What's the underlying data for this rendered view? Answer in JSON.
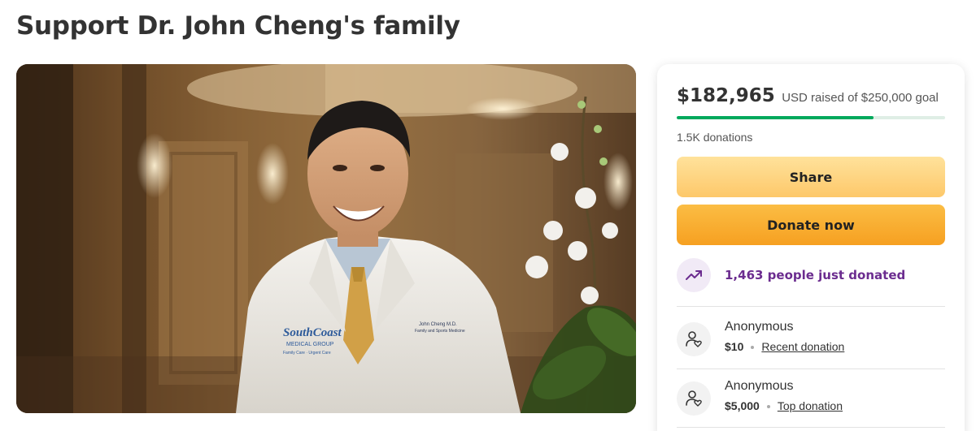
{
  "page": {
    "title": "Support Dr. John Cheng's family"
  },
  "hero_image": {
    "alt": "photo",
    "badge": {
      "logo_line1": "SouthCoast",
      "logo_line2": "MEDICAL GROUP",
      "logo_line3": "Family Care · Urgent Care",
      "name_line1": "John Cheng M.D.",
      "name_line2": "Family and Sports Medicine"
    }
  },
  "fundraiser": {
    "amount_raised": "$182,965",
    "raised_text": "USD raised of $250,000 goal",
    "progress_fraction": 0.7319,
    "donation_count": "1.5K donations",
    "share_label": "Share",
    "donate_label": "Donate now",
    "trend_text": "1,463 people just donated",
    "trend_icon": "trending-up-icon"
  },
  "donations": [
    {
      "name": "Anonymous",
      "amount": "$10",
      "tag": "Recent donation",
      "icon": "donor-heart-icon"
    },
    {
      "name": "Anonymous",
      "amount": "$5,000",
      "tag": "Top donation",
      "icon": "donor-heart-icon"
    }
  ],
  "colors": {
    "progress": "#02a95c",
    "share_button": "#fdc86a",
    "donate_button": "#f6a021",
    "trend_text": "#6b2c8f"
  }
}
